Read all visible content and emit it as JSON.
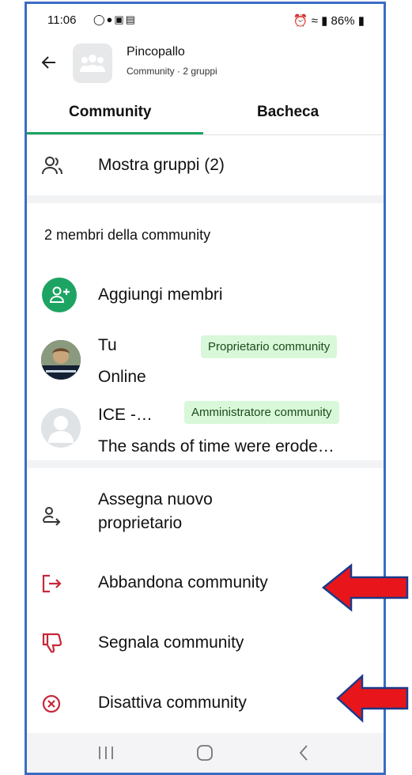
{
  "status_bar": {
    "time": "11:06",
    "battery": "86%"
  },
  "header": {
    "title": "Pincopallo",
    "subtitle": "Community · 2 gruppi"
  },
  "tabs": [
    {
      "label": "Community",
      "active": true
    },
    {
      "label": "Bacheca",
      "active": false
    }
  ],
  "groups_row": {
    "label": "Mostra gruppi (2)"
  },
  "members": {
    "section_title": "2 membri della community",
    "add_label": "Aggiungi membri",
    "list": [
      {
        "name": "Tu",
        "status": "Online",
        "badge": "Proprietario community"
      },
      {
        "name": "ICE -…",
        "status": "The sands of time were erode…",
        "badge": "Amministratore community"
      }
    ]
  },
  "actions": [
    {
      "label": "Assegna nuovo proprietario",
      "icon": "person-transfer-icon"
    },
    {
      "label": "Abbandona community",
      "icon": "exit-icon",
      "color": "#c62839"
    },
    {
      "label": "Segnala community",
      "icon": "thumbs-down-icon",
      "color": "#c62839"
    },
    {
      "label": "Disattiva community",
      "icon": "circle-x-icon",
      "color": "#c62839"
    }
  ],
  "colors": {
    "accent": "#1da462",
    "danger": "#c62839",
    "badge_bg": "#d9f7d9",
    "frame": "#3b6cc4",
    "arrow": "#e8161a"
  }
}
